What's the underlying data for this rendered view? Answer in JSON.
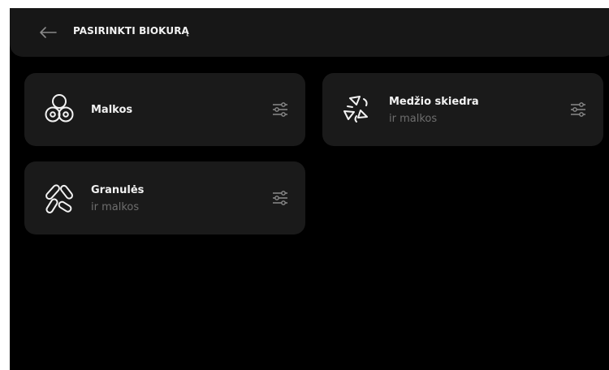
{
  "header": {
    "title": "PASIRINKTI BIOKURĄ",
    "back_icon": "arrow-left-icon"
  },
  "options": [
    {
      "title": "Malkos",
      "subtitle": "",
      "icon": "firewood-icon",
      "settings_icon": "sliders-icon"
    },
    {
      "title": "Medžio skiedra",
      "subtitle": "ir malkos",
      "icon": "wood-chips-icon",
      "settings_icon": "sliders-icon"
    },
    {
      "title": "Granulės",
      "subtitle": "ir malkos",
      "icon": "pellets-icon",
      "settings_icon": "sliders-icon"
    }
  ],
  "colors": {
    "background": "#000000",
    "surface": "#1a1a1a",
    "text": "#f2f2f2",
    "muted_text": "#6e6e6e",
    "icon": "#8a8a8a"
  }
}
